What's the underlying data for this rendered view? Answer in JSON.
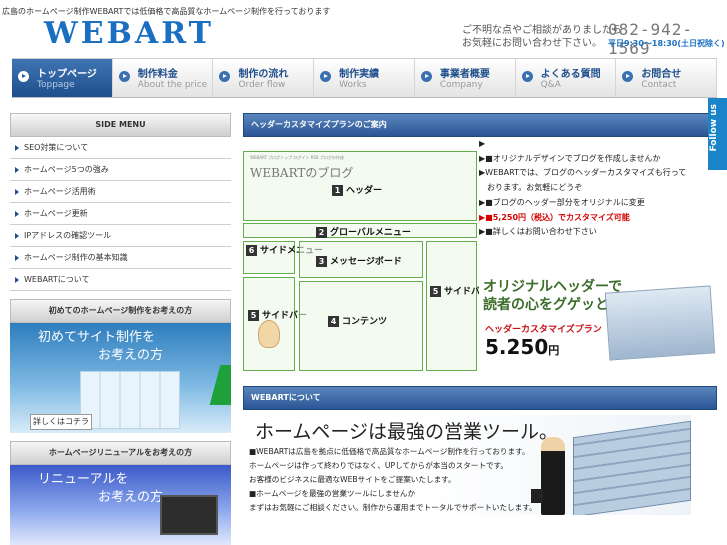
{
  "header": {
    "tagline": "広島のホームページ制作WEBARTでは低価格で高品質なホームページ制作を行っております",
    "logo": "WEBART",
    "contact_line1": "ご不明な点やご相談がありましたら",
    "contact_line2": "お気軽にお問い合わせ下さい。",
    "phone": "082-942-1569",
    "hours": "平日9:30〜18:30(土日祝除く)"
  },
  "nav": [
    {
      "label": "トップページ",
      "sub": "Toppage"
    },
    {
      "label": "制作料金",
      "sub": "About the price"
    },
    {
      "label": "制作の流れ",
      "sub": "Order flow"
    },
    {
      "label": "制作実績",
      "sub": "Works"
    },
    {
      "label": "事業者概要",
      "sub": "Company"
    },
    {
      "label": "よくある質問",
      "sub": "Q&A"
    },
    {
      "label": "お問合せ",
      "sub": "Contact"
    }
  ],
  "sidebar": {
    "heading": "SIDE MENU",
    "items": [
      "SEO対策について",
      "ホームページ5つの強み",
      "ホームページ活用術",
      "ホームページ更新",
      "IPアドレスの確認ツール",
      "ホームページ制作の基本知識",
      "WEBARTについて"
    ],
    "banner1_head": "初めてのホームページ制作をお考えの方",
    "banner1_line1": "初めてサイト制作を",
    "banner1_line2": "お考えの方",
    "banner1_button": "詳しくはコチラ",
    "banner2_head": "ホームページリニューアルをお考えの方",
    "banner2_line1": "リニューアルを",
    "banner2_line2": "お考えの方"
  },
  "main": {
    "heading1": "ヘッダーカスタマイズプランのご案内",
    "diagram": {
      "blog_crumb": "WEBART ブログトップ ログイン RSS ブログの作成",
      "blog_title": "WEBARTのブログ",
      "header_label": "ヘッダー",
      "header_num": "1",
      "globalnav_label": "グローバルメニュー",
      "globalnav_num": "2",
      "sidemenu_label": "サイドメニュー",
      "sidemenu_num": "6",
      "message_label": "メッセージボード",
      "message_num": "3",
      "sidebar_label": "サイドバー",
      "sidebar_num": "5",
      "content_label": "コンテンツ",
      "content_num": "4",
      "sidebar_left_label": "サイドバー",
      "sidebar_left_num": "5"
    },
    "news": [
      "▶",
      "▶■オリジナルデザインでブログを作成しませんか",
      "▶WEBARTでは、ブログのヘッダーカスタマイズも行って",
      "　おります。お気軽にどうぞ",
      "",
      "▶■ブログのヘッダー部分をオリジナルに変更",
      "▶■5,250円（税込）でカスタマイズ可能",
      "▶■詳しくはお問い合わせ下さい"
    ],
    "news_red": "5,250円",
    "ad": {
      "title_line1": "オリジナルヘッダーで",
      "title_line2": "読者の心をグゲッと掴む!!",
      "sub": "ヘッダーカスタマイズプラン",
      "price": "5.250",
      "price_unit": "円"
    },
    "heading2": "WEBARTについて",
    "hero_title": "ホームページは最強の営業ツール。",
    "body": [
      "■WEBARTは広島を拠点に低価格で高品質なホームページ制作を行っております。",
      "ホームページは作って終わりではなく、UPしてからが本当のスタートです。",
      "お客様のビジネスに最適なWEBサイトをご提案いたします。",
      "",
      "■ホームページを最強の営業ツールにしませんか",
      "まずはお気軽にご相談ください。制作から運用までトータルでサポートいたします。"
    ]
  },
  "follow_tab": "Follow us",
  "colors": {
    "brand": "#1a6fc1",
    "nav_active": "#2c5c9e",
    "diagram_green": "#63b04a"
  }
}
